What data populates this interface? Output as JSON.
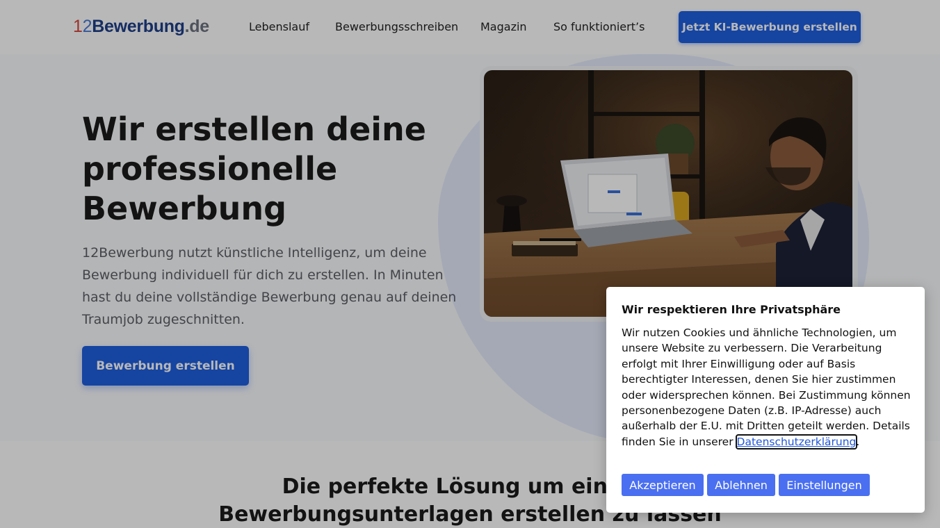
{
  "header": {
    "logo": {
      "part1": "1",
      "part2": "2",
      "part3": "Bewerbung",
      "part4": ".de"
    },
    "nav": [
      "Lebenslauf",
      "Bewerbungsschreiben",
      "Magazin",
      "So funktioniert’s"
    ],
    "cta_label": "Jetzt KI-Bewerbung erstellen"
  },
  "hero": {
    "title": "Wir erstellen deine professionelle Bewerbung",
    "text": "12Bewerbung nutzt künstliche Intelligenz, um deine Bewerbung individuell für dich zu erstellen. In Minuten hast du deine vollständige Bewerbung genau auf deinen Traumjob zugeschnitten.",
    "cta_label": "Bewerbung erstellen"
  },
  "section2": {
    "title": "Die perfekte Lösung um einfach Bewerbungsunterlagen erstellen zu lassen"
  },
  "cookie": {
    "title": "Wir respektieren Ihre Privatsphäre",
    "text": "Wir nutzen Cookies und ähnliche Technologien, um unsere Website zu verbessern. Die Verarbeitung erfolgt mit Ihrer Einwilligung oder auf Basis berechtigter Interessen, denen Sie hier zustimmen oder widersprechen können. Bei Zustimmung können personenbezogene Daten (z.B. IP-Adresse) auch außerhalb der E.U. mit Dritten geteilt werden. Details finden Sie in unserer",
    "link_label": "Datenschutzerklärung",
    "text_end": ".",
    "accept_label": "Akzeptieren",
    "decline_label": "Ablehnen",
    "settings_label": "Einstellungen"
  },
  "colors": {
    "brand_blue": "#1f5fe0",
    "cookie_button": "#4a6ff0",
    "blob": "#e3ebfb"
  }
}
